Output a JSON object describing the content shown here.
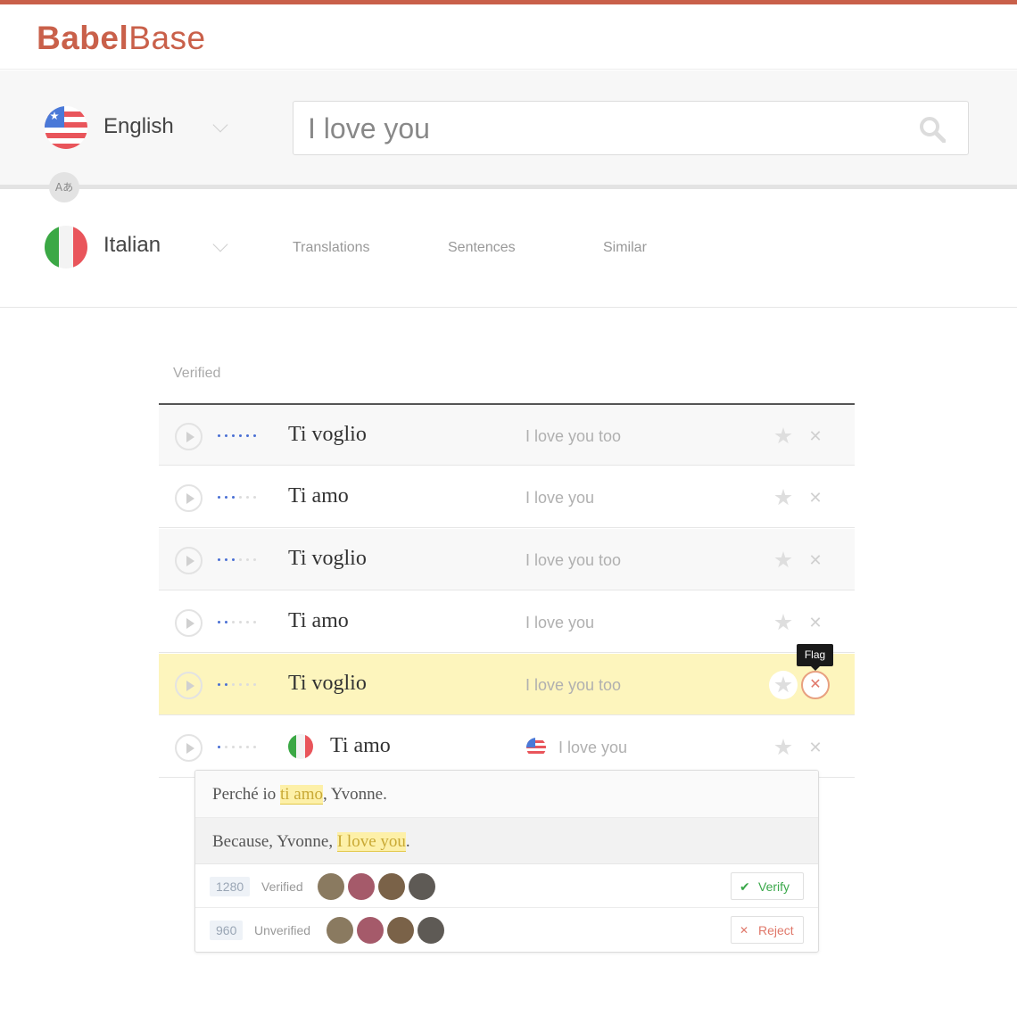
{
  "brand": {
    "bold": "Babel",
    "light": "Base",
    "accent": "#c9604a"
  },
  "languages": {
    "source": {
      "name": "English",
      "flag": "us-flag-icon"
    },
    "target": {
      "name": "Italian",
      "flag": "italy-flag-icon"
    },
    "swap_glyph": "Aあ"
  },
  "search": {
    "value": "I love you",
    "placeholder": ""
  },
  "tabs": [
    "Translations",
    "Sentences",
    "Similar"
  ],
  "results": {
    "section": "Verified",
    "rows": [
      {
        "phrase": "Ti voglio",
        "gloss": "I love you too",
        "strength": 6
      },
      {
        "phrase": "Ti amo",
        "gloss": "I love you",
        "strength": 3
      },
      {
        "phrase": "Ti voglio",
        "gloss": "I love you too",
        "strength": 3
      },
      {
        "phrase": "Ti amo",
        "gloss": "I love you",
        "strength": 2
      },
      {
        "phrase": "Ti voglio",
        "gloss": "I love you too",
        "strength": 2,
        "highlighted": true
      },
      {
        "phrase": "Ti amo",
        "gloss": "I love you",
        "strength": 1,
        "expanded": true
      }
    ],
    "tooltip": "Flag"
  },
  "detail": {
    "source_sentence": {
      "before": "Perché io ",
      "match": "ti amo",
      "after": ", Yvonne."
    },
    "target_sentence": {
      "before": "Because, Yvonne, ",
      "match": "I love you",
      "after": "."
    },
    "verified": {
      "count": "1280",
      "label": "Verified",
      "action": "Verify",
      "action_icon": "✔"
    },
    "unverified": {
      "count": "960",
      "label": "Unverified",
      "action": "Reject",
      "action_icon": "✕"
    }
  },
  "colors": {
    "highlight_row": "#fdf5bd",
    "verify": "#3aa84a",
    "reject": "#e0786a",
    "dot_on": "#4a6fd4"
  }
}
